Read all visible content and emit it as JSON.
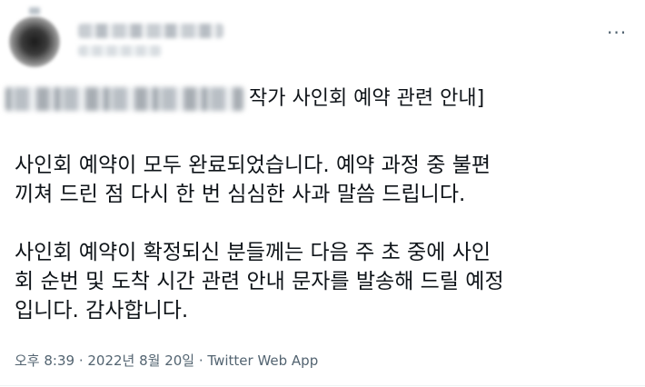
{
  "tweet": {
    "more_label": "···",
    "title_suffix": "작가 사인회 예약 관련 안내]",
    "paragraphs": [
      [
        "사인회 예약이 모두 완료되었습니다. 예약 과정 중 불편",
        "끼쳐 드린 점 다시 한 번 심심한 사과 말씀 드립니다."
      ],
      [
        "사인회 예약이 확정되신 분들께는 다음 주 초 중에 사인",
        "회 순번 및 도착 시간 관련 안내 문자를 발송해 드릴 예정",
        "입니다. 감사합니다."
      ]
    ],
    "timestamp": "오후 8:39 · 2022년 8월 20일 · Twitter Web App"
  },
  "colors": {
    "text": "#0f1419",
    "secondary": "#536471"
  },
  "icons": {
    "more": "more-horizontal-icon"
  }
}
